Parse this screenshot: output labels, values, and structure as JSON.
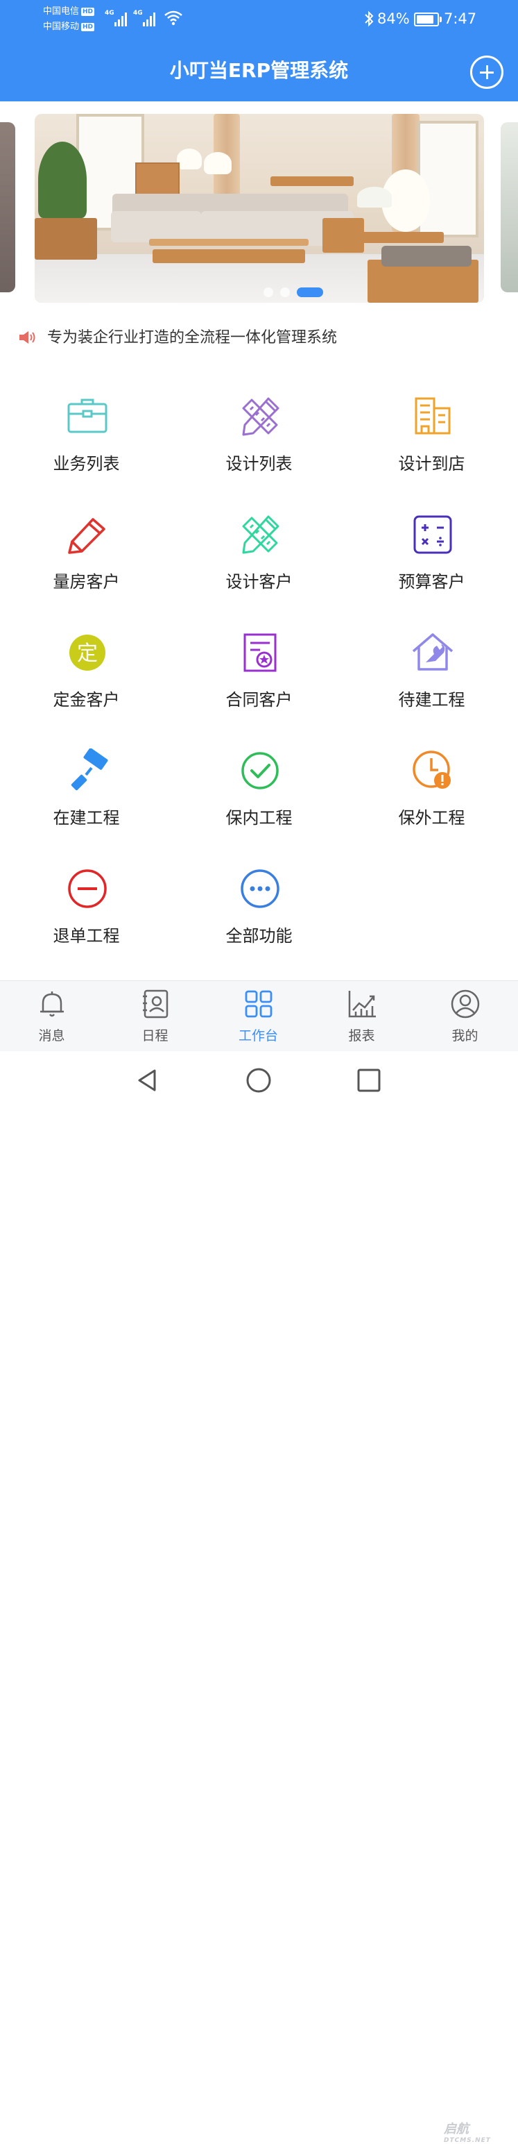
{
  "status_bar": {
    "carrier1": "中国电信",
    "carrier2": "中国移动",
    "hd_badge": "HD",
    "net_label": "4G",
    "battery_percent_text": "84%",
    "battery_level": 0.84,
    "time": "7:47",
    "icons": [
      "bluetooth-icon",
      "wifi-icon",
      "signal-icon",
      "battery-icon"
    ]
  },
  "header": {
    "title": "小叮当ERP管理系统",
    "add_icon": "plus-circle-icon"
  },
  "banner": {
    "slide_count": 3,
    "active_index": 2
  },
  "notice": {
    "icon": "speaker-icon",
    "text": "专为装企行业打造的全流程一体化管理系统"
  },
  "grid": {
    "items": [
      {
        "label": "业务列表",
        "icon": "briefcase-icon",
        "color": "#5bc8c8"
      },
      {
        "label": "设计列表",
        "icon": "ruler-pencil-icon",
        "color": "#9b6fcf"
      },
      {
        "label": "设计到店",
        "icon": "building-icon",
        "color": "#f0a32a"
      },
      {
        "label": "量房客户",
        "icon": "pencil-icon",
        "color": "#e0332e"
      },
      {
        "label": "设计客户",
        "icon": "ruler-pencil-icon",
        "color": "#2fd79d"
      },
      {
        "label": "预算客户",
        "icon": "calculator-icon",
        "color": "#4a2fb8"
      },
      {
        "label": "定金客户",
        "icon": "deposit-badge-icon",
        "color": "#c9cc18",
        "badge_text": "定"
      },
      {
        "label": "合同客户",
        "icon": "contract-icon",
        "color": "#9a2fd0"
      },
      {
        "label": "待建工程",
        "icon": "house-wrench-icon",
        "color": "#8f88e8"
      },
      {
        "label": "在建工程",
        "icon": "paint-roller-icon",
        "color": "#2f8ff0"
      },
      {
        "label": "保内工程",
        "icon": "check-circle-icon",
        "color": "#2fbd5a"
      },
      {
        "label": "保外工程",
        "icon": "clock-alert-icon",
        "color": "#f08a28"
      },
      {
        "label": "退单工程",
        "icon": "minus-circle-icon",
        "color": "#e02626"
      },
      {
        "label": "全部功能",
        "icon": "more-circle-icon",
        "color": "#3a7fe0"
      }
    ]
  },
  "tabbar": {
    "items": [
      {
        "label": "消息",
        "icon": "bell-icon"
      },
      {
        "label": "日程",
        "icon": "contacts-book-icon"
      },
      {
        "label": "工作台",
        "icon": "grid-icon"
      },
      {
        "label": "报表",
        "icon": "chart-icon"
      },
      {
        "label": "我的",
        "icon": "user-icon"
      }
    ],
    "active_index": 2,
    "active_color": "#3a8ef6"
  },
  "system_nav": {
    "buttons": [
      "back-icon",
      "home-icon",
      "recents-icon"
    ],
    "watermark": "启航",
    "watermark_sub": "DTCMS.NET"
  },
  "colors": {
    "primary": "#3a8ef6",
    "text": "#222222"
  }
}
